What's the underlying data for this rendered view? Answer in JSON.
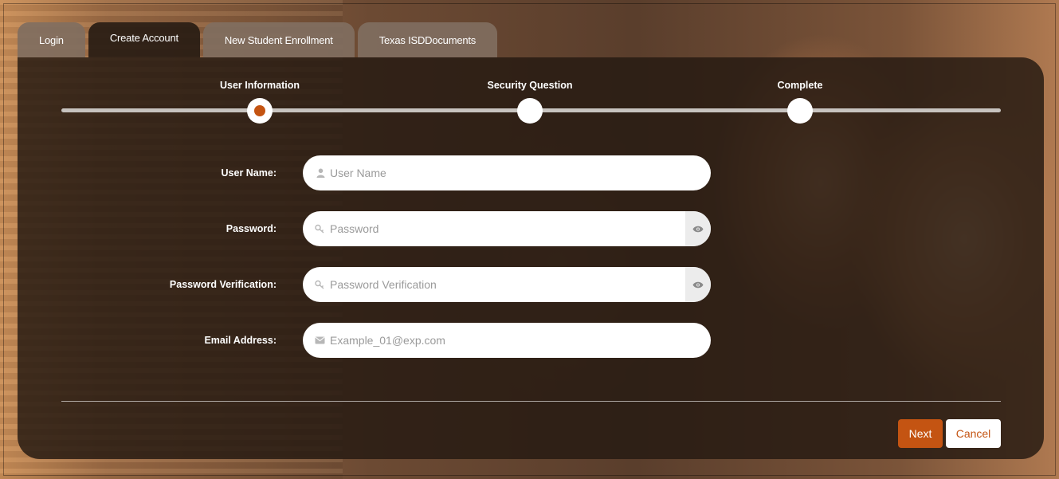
{
  "tabs": [
    {
      "label": "Login",
      "active": false
    },
    {
      "label": "Create Account",
      "active": true
    },
    {
      "label": "New Student Enrollment",
      "active": false
    },
    {
      "label": "Texas ISDDocuments",
      "active": false
    }
  ],
  "stepper": {
    "steps": [
      {
        "label": "User Information",
        "state": "current"
      },
      {
        "label": "Security Question",
        "state": "upcoming"
      },
      {
        "label": "Complete",
        "state": "upcoming"
      }
    ]
  },
  "form": {
    "user_name": {
      "label": "User Name:",
      "placeholder": "User Name",
      "value": "",
      "icon": "user-icon"
    },
    "password": {
      "label": "Password:",
      "placeholder": "Password",
      "value": "",
      "icon": "key-icon",
      "toggle_icon": "eye-icon"
    },
    "password_verification": {
      "label": "Password Verification:",
      "placeholder": "Password Verification",
      "value": "",
      "icon": "key-icon",
      "toggle_icon": "eye-icon"
    },
    "email": {
      "label": "Email Address:",
      "placeholder": "Example_01@exp.com",
      "value": "",
      "icon": "envelope-icon"
    }
  },
  "actions": {
    "next_label": "Next",
    "cancel_label": "Cancel"
  },
  "colors": {
    "accent": "#c45412",
    "panel": "#261a12",
    "tab_inactive": "#806e60",
    "white": "#ffffff"
  }
}
